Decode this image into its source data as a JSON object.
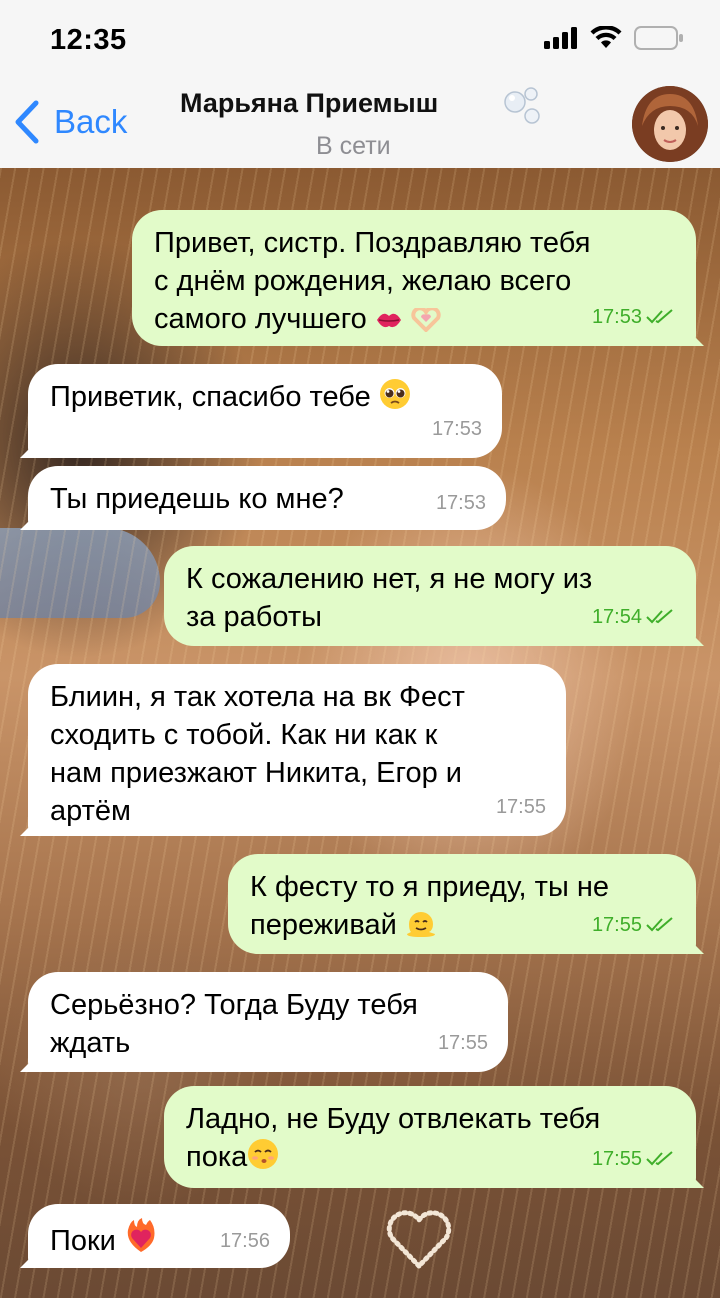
{
  "status_bar": {
    "time": "12:35"
  },
  "header": {
    "back_label": "Back",
    "contact_name": "Марьяна Приемыш",
    "contact_status": "В сети"
  },
  "colors": {
    "accent": "#2f88ff",
    "outgoing_bubble": "#e2fbc9",
    "incoming_bubble": "#ffffff",
    "read_check": "#3fae2a"
  },
  "messages": [
    {
      "dir": "out",
      "lines": [
        "Привет, систр. Поздравляю тебя",
        "с днём рождения, желаю всего",
        "самого лучшего"
      ],
      "emoji": [
        "kiss-lips-icon",
        "heart-hands-icon"
      ],
      "time": "17:53",
      "read": true
    },
    {
      "dir": "in",
      "lines": [
        "Приветик, спасибо тебе"
      ],
      "emoji": [
        "pleading-face-icon"
      ],
      "time": "17:53"
    },
    {
      "dir": "in",
      "lines": [
        "Ты приедешь ко мне?"
      ],
      "time": "17:53"
    },
    {
      "dir": "out",
      "lines": [
        "К сожалению нет, я не могу из",
        "за работы"
      ],
      "time": "17:54",
      "read": true
    },
    {
      "dir": "in",
      "lines": [
        "Блиин, я так хотела на вк Фест",
        "сходить с тобой. Как ни как к",
        "нам приезжают Никита, Егор и",
        "артём"
      ],
      "time": "17:55"
    },
    {
      "dir": "out",
      "lines": [
        "К фесту то я приеду, ты не",
        "переживай"
      ],
      "emoji": [
        "melting-face-icon"
      ],
      "time": "17:55",
      "read": true
    },
    {
      "dir": "in",
      "lines": [
        "Серьёзно? Тогда Буду тебя",
        "ждать"
      ],
      "time": "17:55"
    },
    {
      "dir": "out",
      "lines": [
        "Ладно, не Буду отвлекать тебя",
        "пока"
      ],
      "emoji": [
        "kissing-face-icon"
      ],
      "time": "17:55",
      "read": true
    },
    {
      "dir": "in",
      "lines": [
        "Поки"
      ],
      "emoji": [
        "heart-on-fire-icon"
      ],
      "time": "17:56"
    }
  ]
}
